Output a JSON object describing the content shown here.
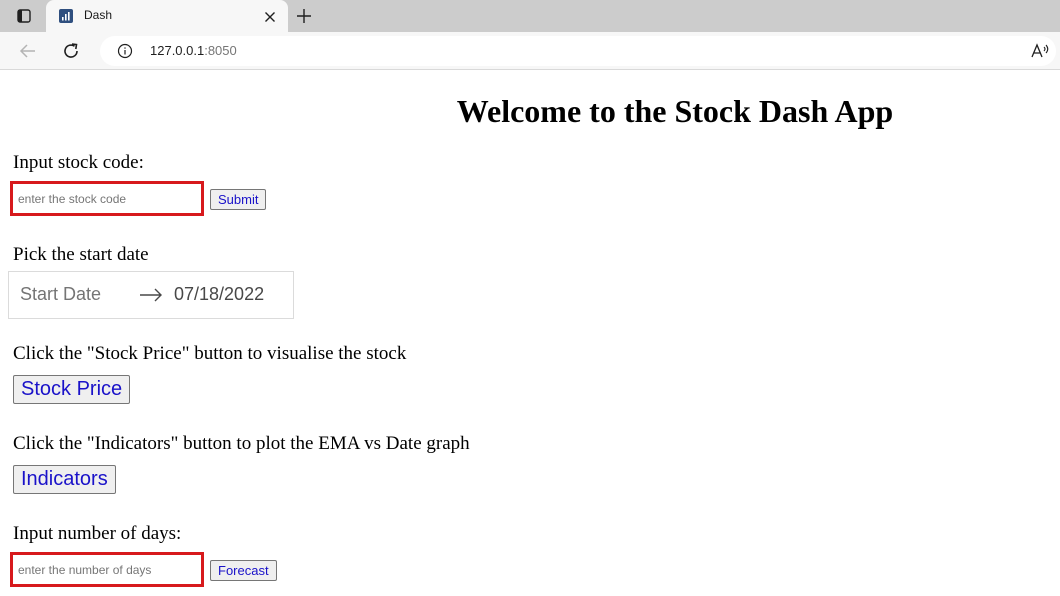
{
  "browser": {
    "tab_title": "Dash",
    "url_host": "127.0.0.1",
    "url_port": ":8050",
    "icons": {
      "tab_actions": "tab-actions-icon",
      "favicon": "dash-favicon-icon",
      "close": "close-icon",
      "new_tab": "plus-icon",
      "back": "back-arrow-icon",
      "reload": "reload-icon",
      "site_info": "info-icon",
      "read_aloud": "read-aloud-icon"
    }
  },
  "page": {
    "title": "Welcome to the Stock Dash App",
    "stock": {
      "label": "Input stock code:",
      "placeholder": "enter the stock code",
      "value": "",
      "submit_label": "Submit"
    },
    "date": {
      "label": "Pick the start date",
      "start_placeholder": "Start Date",
      "end_value": "07/18/2022"
    },
    "price": {
      "label": "Click the \"Stock Price\" button to visualise the stock",
      "button_label": "Stock Price"
    },
    "indicators": {
      "label": "Click the \"Indicators\" button to plot the EMA vs Date graph",
      "button_label": "Indicators"
    },
    "forecast": {
      "label": "Input number of days:",
      "placeholder": "enter the number of days",
      "value": "",
      "button_label": "Forecast"
    }
  },
  "colors": {
    "input_border": "#d7191c",
    "button_text": "#1a12c9",
    "tabstrip": "#cccccc",
    "toolbar": "#f7f7f7"
  }
}
